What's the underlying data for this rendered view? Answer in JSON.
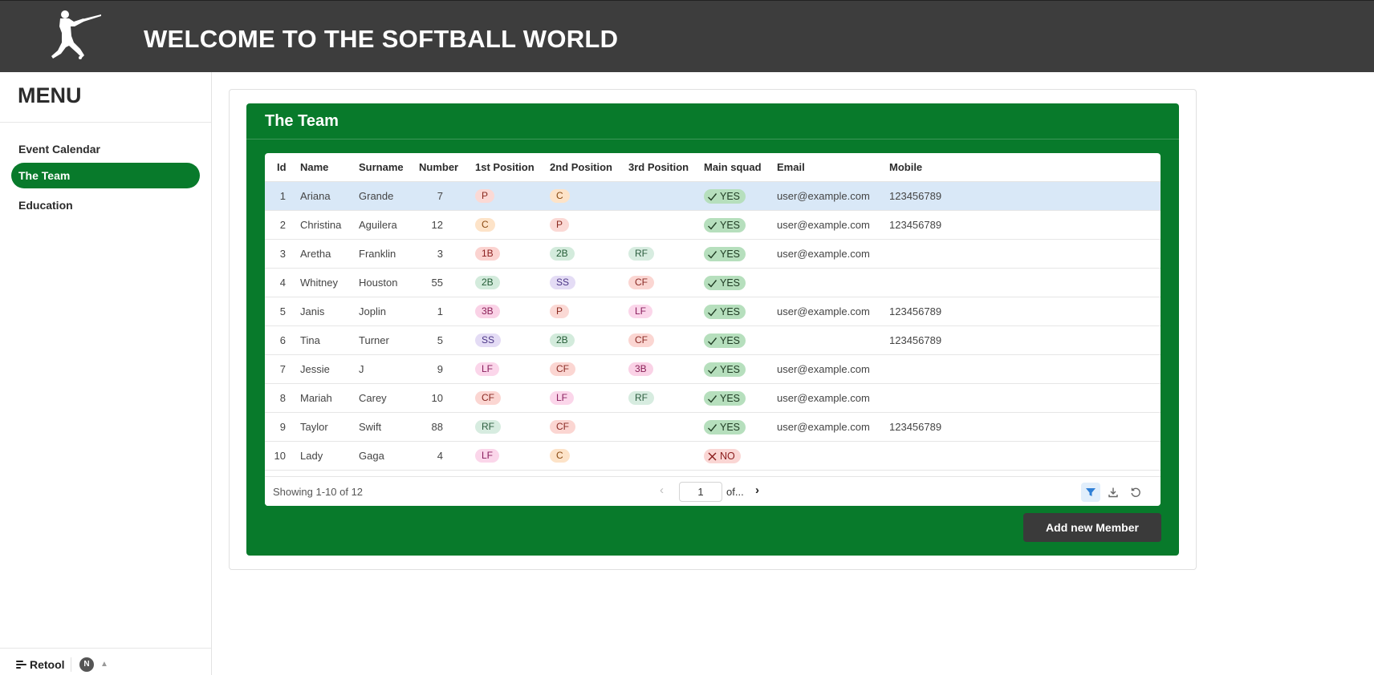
{
  "header": {
    "title": "WELCOME TO THE SOFTBALL WORLD",
    "logo_icon": "batter-silhouette-icon"
  },
  "sidebar": {
    "menu_title": "MENU",
    "items": [
      {
        "label": "Event Calendar",
        "active": false
      },
      {
        "label": "The Team",
        "active": true
      },
      {
        "label": "Education",
        "active": false
      }
    ],
    "footer": {
      "brand": "Retool",
      "avatar_initial": "N"
    }
  },
  "panel": {
    "title": "The Team",
    "accent_color": "#087a2b"
  },
  "table": {
    "columns": [
      "Id",
      "Name",
      "Surname",
      "Number",
      "1st Position",
      "2nd Position",
      "3rd Position",
      "Main squad",
      "Email",
      "Mobile"
    ],
    "rows": [
      {
        "id": "1",
        "name": "Ariana",
        "surname": "Grande",
        "number": "7",
        "pos1": "P",
        "pos2": "C",
        "pos3": "",
        "squad": "YES",
        "email": "user@example.com",
        "mobile": "123456789",
        "selected": true
      },
      {
        "id": "2",
        "name": "Christina",
        "surname": "Aguilera",
        "number": "12",
        "pos1": "C",
        "pos2": "P",
        "pos3": "",
        "squad": "YES",
        "email": "user@example.com",
        "mobile": "123456789"
      },
      {
        "id": "3",
        "name": "Aretha",
        "surname": "Franklin",
        "number": "3",
        "pos1": "1B",
        "pos2": "2B",
        "pos3": "RF",
        "squad": "YES",
        "email": "user@example.com",
        "mobile": ""
      },
      {
        "id": "4",
        "name": "Whitney",
        "surname": "Houston",
        "number": "55",
        "pos1": "2B",
        "pos2": "SS",
        "pos3": "CF",
        "squad": "YES",
        "email": "",
        "mobile": ""
      },
      {
        "id": "5",
        "name": "Janis",
        "surname": "Joplin",
        "number": "1",
        "pos1": "3B",
        "pos2": "P",
        "pos3": "LF",
        "squad": "YES",
        "email": "user@example.com",
        "mobile": "123456789"
      },
      {
        "id": "6",
        "name": "Tina",
        "surname": "Turner",
        "number": "5",
        "pos1": "SS",
        "pos2": "2B",
        "pos3": "CF",
        "squad": "YES",
        "email": "",
        "mobile": "123456789"
      },
      {
        "id": "7",
        "name": "Jessie",
        "surname": "J",
        "number": "9",
        "pos1": "LF",
        "pos2": "CF",
        "pos3": "3B",
        "squad": "YES",
        "email": "user@example.com",
        "mobile": ""
      },
      {
        "id": "8",
        "name": "Mariah",
        "surname": "Carey",
        "number": "10",
        "pos1": "CF",
        "pos2": "LF",
        "pos3": "RF",
        "squad": "YES",
        "email": "user@example.com",
        "mobile": ""
      },
      {
        "id": "9",
        "name": "Taylor",
        "surname": "Swift",
        "number": "88",
        "pos1": "RF",
        "pos2": "CF",
        "pos3": "",
        "squad": "YES",
        "email": "user@example.com",
        "mobile": "123456789"
      },
      {
        "id": "10",
        "name": "Lady",
        "surname": "Gaga",
        "number": "4",
        "pos1": "LF",
        "pos2": "C",
        "pos3": "",
        "squad": "NO",
        "email": "",
        "mobile": ""
      }
    ],
    "position_colors": {
      "P": {
        "bg": "#fbd9d5",
        "fg": "#8a2a1f"
      },
      "C": {
        "bg": "#fde3c8",
        "fg": "#8a4a12"
      },
      "1B": {
        "bg": "#fbd3d0",
        "fg": "#8a1f1f"
      },
      "2B": {
        "bg": "#d3ebdc",
        "fg": "#245c36"
      },
      "SS": {
        "bg": "#e4dcf5",
        "fg": "#4a3585"
      },
      "3B": {
        "bg": "#fad2e6",
        "fg": "#8a1f56"
      },
      "LF": {
        "bg": "#fbd6ea",
        "fg": "#8a1f5e"
      },
      "CF": {
        "bg": "#fbd6d2",
        "fg": "#8a2a24"
      },
      "RF": {
        "bg": "#d7ece0",
        "fg": "#2d5e40"
      }
    },
    "footer": {
      "showing": "Showing 1-10 of 12",
      "page_value": "1",
      "page_of": "of...",
      "tools": [
        "filter-icon",
        "download-icon",
        "refresh-icon"
      ]
    }
  },
  "actions": {
    "add_member": "Add new Member"
  }
}
